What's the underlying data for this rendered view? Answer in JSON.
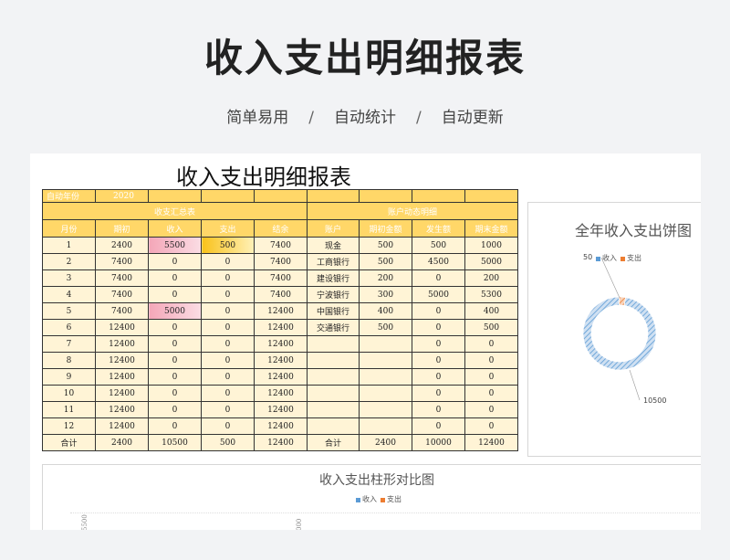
{
  "hero": {
    "title": "收入支出明细报表",
    "taglines": [
      "简单易用",
      "自动统计",
      "自动更新"
    ],
    "separator": "/"
  },
  "sheet": {
    "title": "收入支出明细报表",
    "year_label": "自动年份",
    "year_value": "2020",
    "section_summary": "收支汇总表",
    "section_accounts": "账户动态明细",
    "headers": [
      "月份",
      "期初",
      "收入",
      "支出",
      "结余",
      "账户",
      "期初金额",
      "发生额",
      "期末金额"
    ],
    "rows": [
      [
        "1",
        "2400",
        "5500",
        "500",
        "7400",
        "现金",
        "500",
        "500",
        "1000"
      ],
      [
        "2",
        "7400",
        "0",
        "0",
        "7400",
        "工商银行",
        "500",
        "4500",
        "5000"
      ],
      [
        "3",
        "7400",
        "0",
        "0",
        "7400",
        "建设银行",
        "200",
        "0",
        "200"
      ],
      [
        "4",
        "7400",
        "0",
        "0",
        "7400",
        "宁波银行",
        "300",
        "5000",
        "5300"
      ],
      [
        "5",
        "7400",
        "5000",
        "0",
        "12400",
        "中国银行",
        "400",
        "0",
        "400"
      ],
      [
        "6",
        "12400",
        "0",
        "0",
        "12400",
        "交通银行",
        "500",
        "0",
        "500"
      ],
      [
        "7",
        "12400",
        "0",
        "0",
        "12400",
        "",
        "",
        "0",
        "0"
      ],
      [
        "8",
        "12400",
        "0",
        "0",
        "12400",
        "",
        "",
        "0",
        "0"
      ],
      [
        "9",
        "12400",
        "0",
        "0",
        "12400",
        "",
        "",
        "0",
        "0"
      ],
      [
        "10",
        "12400",
        "0",
        "0",
        "12400",
        "",
        "",
        "0",
        "0"
      ],
      [
        "11",
        "12400",
        "0",
        "0",
        "12400",
        "",
        "",
        "0",
        "0"
      ],
      [
        "12",
        "12400",
        "0",
        "0",
        "12400",
        "",
        "",
        "0",
        "0"
      ]
    ],
    "total": [
      "合计",
      "2400",
      "10500",
      "500",
      "12400",
      "合计",
      "2400",
      "10000",
      "12400"
    ],
    "bar_fill": {
      "income_max": 5500,
      "expense_max": 500
    }
  },
  "pie": {
    "title": "全年收入支出饼图",
    "legend": [
      {
        "name": "收入",
        "color": "#5b9bd5"
      },
      {
        "name": "支出",
        "color": "#ed7d31"
      }
    ],
    "chart_data": {
      "type": "pie",
      "categories": [
        "收入",
        "支出"
      ],
      "values": [
        10500,
        50
      ]
    },
    "labels": [
      "50",
      "10500"
    ]
  },
  "bar": {
    "title": "收入支出柱形对比图",
    "legend": [
      {
        "name": "收入",
        "color": "#5b9bd5"
      },
      {
        "name": "支出",
        "color": "#ed7d31"
      }
    ],
    "ticks": [
      "5500",
      "000"
    ]
  }
}
